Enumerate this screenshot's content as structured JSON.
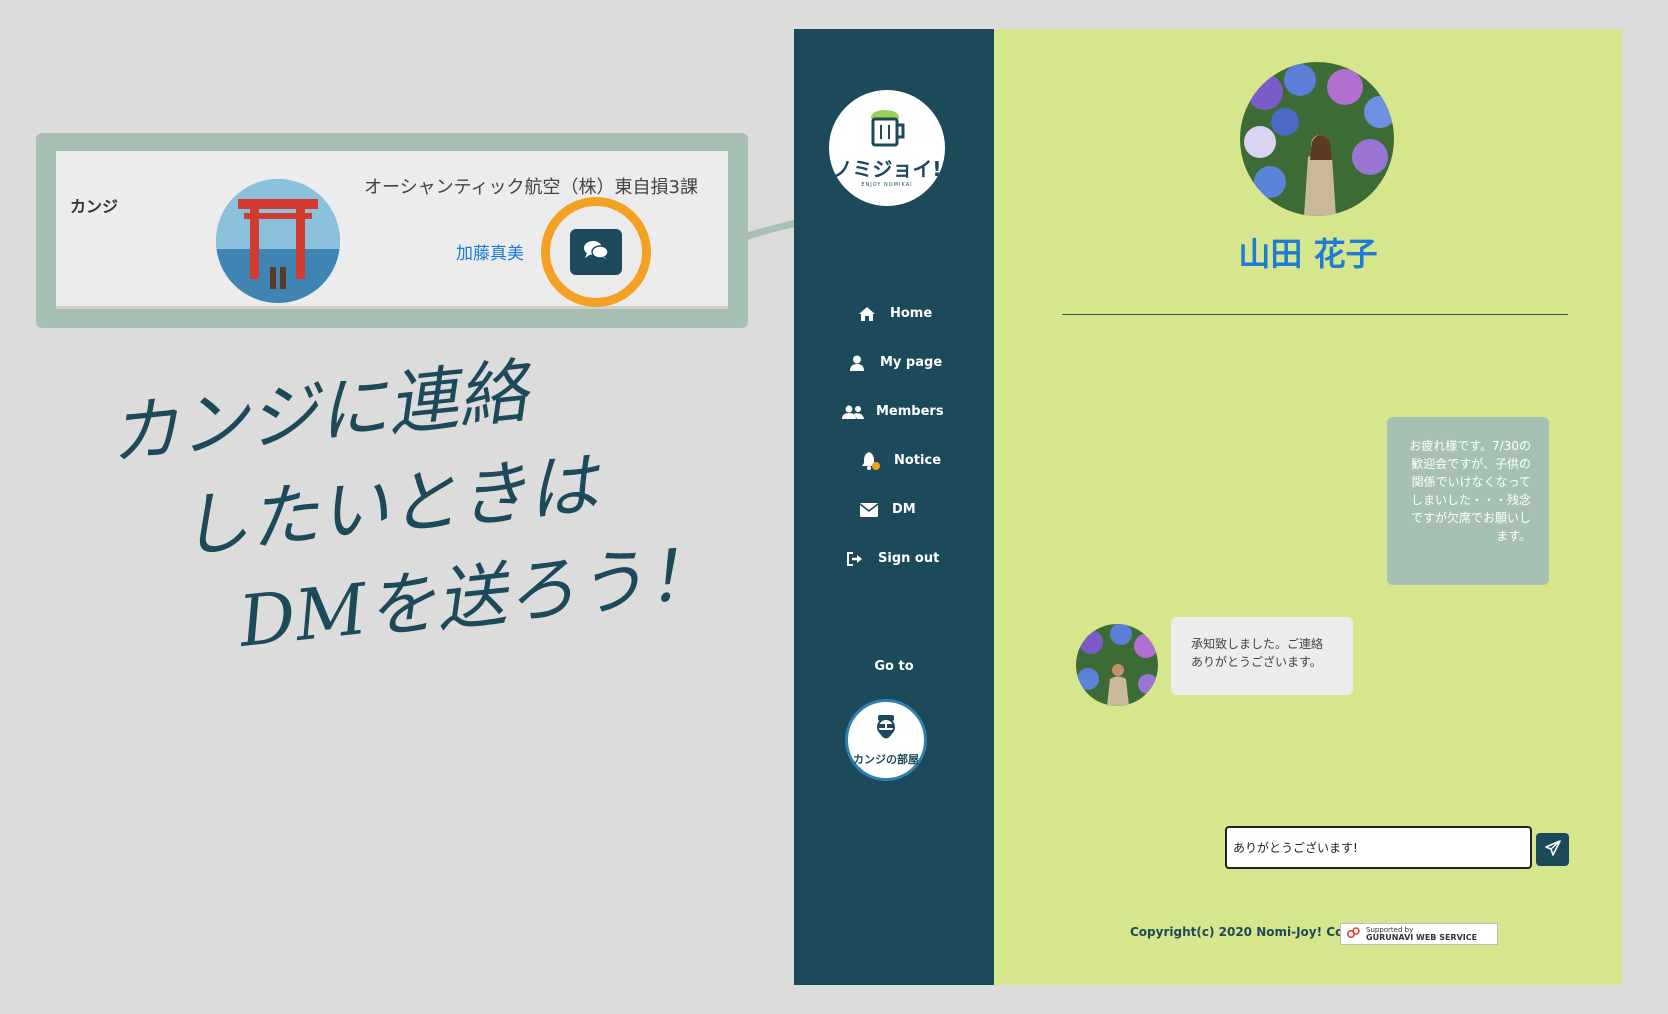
{
  "callout": {
    "tag": "カンジ",
    "company": "オーシャンティック航空（株）東自損3課",
    "person_name": "加藤真美",
    "dm_button_icon": "chat-bubbles-icon",
    "highlight_color": "#f3a123"
  },
  "handwriting": {
    "line1": "カンジに連絡",
    "line2": "したいときは",
    "line3": "DMを送ろう！"
  },
  "app": {
    "logo_text": "ノミジョイ!",
    "logo_sub": "ENJOY NOMIKAI",
    "nav": [
      {
        "label": "Home",
        "icon": "home-icon"
      },
      {
        "label": "My page",
        "icon": "user-icon"
      },
      {
        "label": "Members",
        "icon": "users-icon"
      },
      {
        "label": "Notice",
        "icon": "bell-icon"
      },
      {
        "label": "DM",
        "icon": "envelope-icon"
      },
      {
        "label": "Sign out",
        "icon": "sign-out-icon"
      }
    ],
    "goto_label": "Go to",
    "kanji_room_label": "カンジの部屋",
    "profile_name": "山田 花子",
    "messages": [
      {
        "side": "right",
        "text": "お疲れ様です。7/30の歓迎会ですが、子供の関係でいけなくなってしまいした・・・残念ですが欠席でお願いします。"
      },
      {
        "side": "left",
        "text": "承知致しました。ご連絡ありがとうございます。"
      }
    ],
    "input_value": "ありがとうございます!",
    "send_icon": "paper-plane-icon",
    "copyright": "Copyright(c) 2020 Nomi-Joy! Co.,Ltd",
    "gurunavi_line1": "Supported by",
    "gurunavi_line2": "GURUNAVI WEB SERVICE",
    "colors": {
      "sidebar": "#1d4a5b",
      "main": "#d6e68c",
      "accent_blue": "#1e7bd6"
    }
  }
}
